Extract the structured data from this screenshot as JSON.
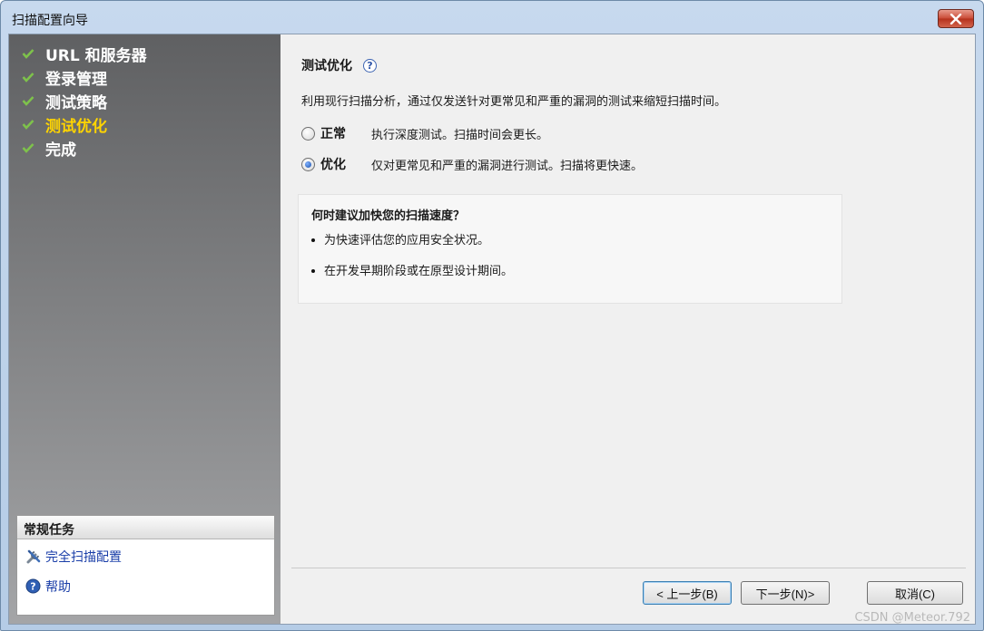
{
  "window": {
    "title": "扫描配置向导"
  },
  "steps": [
    {
      "label": "URL 和服务器",
      "done": true,
      "active": false
    },
    {
      "label": "登录管理",
      "done": true,
      "active": false
    },
    {
      "label": "测试策略",
      "done": true,
      "active": false
    },
    {
      "label": "测试优化",
      "done": true,
      "active": true
    },
    {
      "label": "完成",
      "done": true,
      "active": false
    }
  ],
  "tasks": {
    "header": "常规任务",
    "items": [
      {
        "label": "完全扫描配置",
        "icon": "tools-icon"
      },
      {
        "label": "帮助",
        "icon": "help-icon"
      }
    ]
  },
  "main": {
    "title": "测试优化",
    "description": "利用现行扫描分析，通过仅发送针对更常见和严重的漏洞的测试来缩短扫描时间。",
    "options": [
      {
        "label": "正常",
        "description": "执行深度测试。扫描时间会更长。",
        "checked": false
      },
      {
        "label": "优化",
        "description": "仅对更常见和严重的漏洞进行测试。扫描将更快速。",
        "checked": true
      }
    ],
    "info": {
      "title": "何时建议加快您的扫描速度？",
      "bullets": [
        "为快速评估您的应用安全状况。",
        "在开发早期阶段或在原型设计期间。"
      ]
    }
  },
  "buttons": {
    "back": "< 上一步(B)",
    "next": "下一步(N)>",
    "cancel": "取消(C)"
  },
  "watermark": "CSDN @Meteor.792",
  "colors": {
    "active_step": "#ffd400",
    "check": "#7ec24b",
    "link": "#1a3ea8"
  }
}
